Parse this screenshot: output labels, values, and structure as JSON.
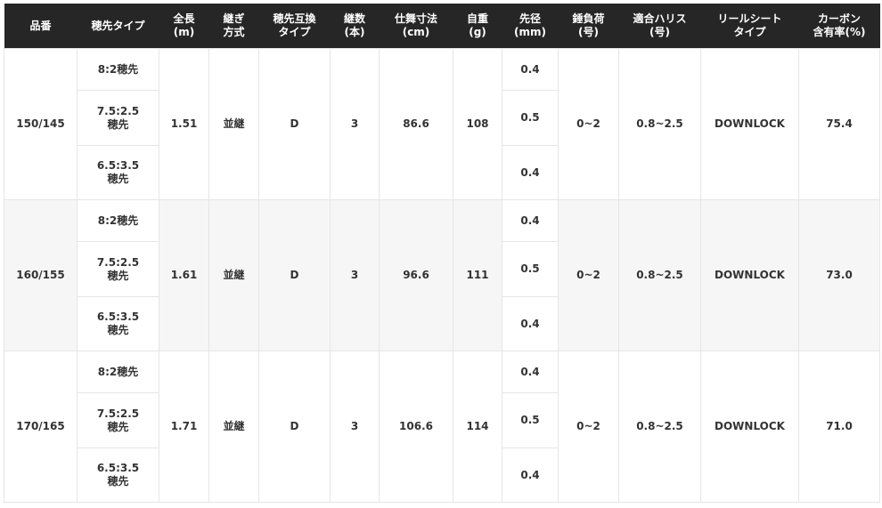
{
  "headers": [
    "品番",
    "穂先タイプ",
    "全長\n(m)",
    "継ぎ\n方式",
    "穂先互換\nタイプ",
    "継数\n(本)",
    "仕舞寸法\n(cm)",
    "自重\n(g)",
    "先径\n(mm)",
    "錘負荷\n(号)",
    "適合ハリス\n(号)",
    "リールシート\nタイプ",
    "カーボン\n含有率(%)"
  ],
  "rows": [
    {
      "model": "150/145",
      "tips": [
        "8:2穂先",
        "7.5:2.5\n穂先",
        "6.5:3.5\n穂先"
      ],
      "length": "1.51",
      "joint": "並継",
      "tip_compat": "D",
      "sections": "3",
      "closed_length": "86.6",
      "weight": "108",
      "tip_dia": [
        "0.4",
        "0.5",
        "0.4"
      ],
      "sinker": "0~2",
      "leader": "0.8~2.5",
      "reel_seat": "DOWNLOCK",
      "carbon": "75.4"
    },
    {
      "model": "160/155",
      "tips": [
        "8:2穂先",
        "7.5:2.5\n穂先",
        "6.5:3.5\n穂先"
      ],
      "length": "1.61",
      "joint": "並継",
      "tip_compat": "D",
      "sections": "3",
      "closed_length": "96.6",
      "weight": "111",
      "tip_dia": [
        "0.4",
        "0.5",
        "0.4"
      ],
      "sinker": "0~2",
      "leader": "0.8~2.5",
      "reel_seat": "DOWNLOCK",
      "carbon": "73.0"
    },
    {
      "model": "170/165",
      "tips": [
        "8:2穂先",
        "7.5:2.5\n穂先",
        "6.5:3.5\n穂先"
      ],
      "length": "1.71",
      "joint": "並継",
      "tip_compat": "D",
      "sections": "3",
      "closed_length": "106.6",
      "weight": "114",
      "tip_dia": [
        "0.4",
        "0.5",
        "0.4"
      ],
      "sinker": "0~2",
      "leader": "0.8~2.5",
      "reel_seat": "DOWNLOCK",
      "carbon": "71.0"
    }
  ],
  "colors": {
    "header_bg": "#262626",
    "header_text": "#ffffff",
    "body_text": "#333333",
    "border": "#e6e6e6",
    "stripe_bg": "#f6f6f6"
  }
}
